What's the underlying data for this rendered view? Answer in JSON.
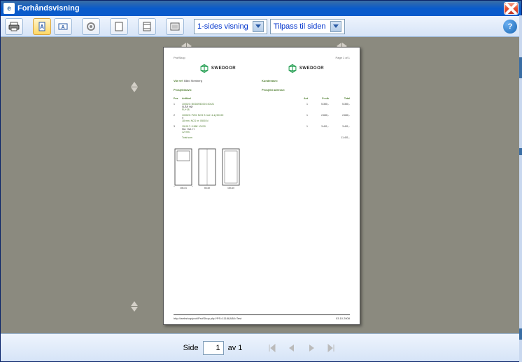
{
  "window": {
    "title": "Forhåndsvisning",
    "icon_letter": "e"
  },
  "toolbar": {
    "view_select": "1-sides visning",
    "zoom_select": "Tilpass til siden"
  },
  "page_preview": {
    "header_left": "ProfShop",
    "header_right": "Page 1 of  1",
    "brand": "SWEDOOR",
    "labels": {
      "vaar_ref": "Vår ref:",
      "kundenavn": "Kundenavn:"
    },
    "vaar_ref_val": "Bård Stenberg",
    "prosjekt_left": "Prosjektnavn:",
    "prosjekt_right": "Prosjekt adresse:",
    "columns": {
      "c1": "Pos",
      "c2": "Artikkel",
      "c3": "Ant",
      "c4": "Pr stk",
      "c5": "Total"
    },
    "rows": [
      {
        "pos": "1",
        "art": "100023: BODØ BD30 100x21",
        "art2": "SLÅR HØ",
        "art3": "FU+18.",
        "q": "1",
        "p": "5.350,-",
        "t": "5.350,-"
      },
      {
        "pos": "2",
        "art": "100023: P201 NCS S hvit f.b.kj 90X20",
        "art2": "V",
        "art3": "18 mm. NCS nr: 0500-N",
        "q": "1",
        "p": "2.650,-",
        "t": "2.650,-"
      },
      {
        "pos": "3",
        "art": "151017: KJØK 10X20",
        "art2": "Std. Hvit. H",
        "art3": "12 mm.",
        "q": "1",
        "p": "3.401,-",
        "t": "3.401,-"
      }
    ],
    "total_label": "Total sum",
    "total_val": "11.401,-",
    "door_dims": [
      "100x21",
      "90x20",
      "100x20"
    ],
    "footer_url": "http://webshop/prof/ProfShop.php?PS=1118&A38=Test",
    "footer_date": "03.10.2008"
  },
  "bottom": {
    "side_label": "Side",
    "page_num": "1",
    "av_label": "av 1"
  }
}
